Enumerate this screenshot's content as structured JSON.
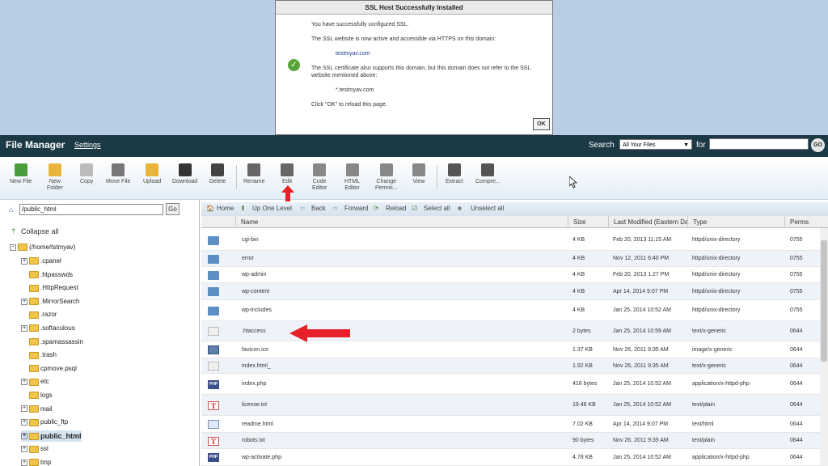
{
  "dialog": {
    "title": "SSL Host Successfully Installed",
    "line1": "You have successfully configured SSL.",
    "line2": "The SSL website is now active and accessible via HTTPS on this domain:",
    "domain": "testmyav.com",
    "line3": "The SSL certificate also supports this domain, but this domain does not refer to the SSL website mentioned above:",
    "wildcard": "*.testmyav.com",
    "line4": "Click \"OK\" to reload this page.",
    "ok_label": "OK"
  },
  "header": {
    "title": "File Manager",
    "settings": "Settings",
    "search_label": "Search",
    "search_scope": "All Your Files",
    "for_label": "for",
    "go_label": "GO"
  },
  "toolbar": [
    {
      "label": "New File",
      "icon": "new-file-icon"
    },
    {
      "label": "New\nFolder",
      "icon": "new-folder-icon"
    },
    {
      "label": "Copy",
      "icon": "copy-icon"
    },
    {
      "label": "Move File",
      "icon": "move-file-icon"
    },
    {
      "label": "Upload",
      "icon": "upload-icon"
    },
    {
      "label": "Download",
      "icon": "download-icon"
    },
    {
      "label": "Delete",
      "icon": "delete-icon"
    },
    {
      "label": "Rename",
      "icon": "rename-icon"
    },
    {
      "label": "Edit",
      "icon": "edit-icon"
    },
    {
      "label": "Code\nEditor",
      "icon": "code-editor-icon"
    },
    {
      "label": "HTML\nEditor",
      "icon": "html-editor-icon"
    },
    {
      "label": "Change\nPermis...",
      "icon": "change-permissions-icon"
    },
    {
      "label": "View",
      "icon": "view-icon"
    },
    {
      "label": "Extract",
      "icon": "extract-icon"
    },
    {
      "label": "Compre...",
      "icon": "compress-icon"
    }
  ],
  "tree": {
    "path": "/public_html",
    "go_label": "Go",
    "collapse_all": "Collapse all",
    "root": "(/home/tstmyav)",
    "items": [
      {
        "label": ".cpanel",
        "expandable": true
      },
      {
        "label": ".htpasswds",
        "expandable": false
      },
      {
        "label": ".HttpRequest",
        "expandable": false
      },
      {
        "label": ".MirrorSearch",
        "expandable": true
      },
      {
        "label": ".razor",
        "expandable": false
      },
      {
        "label": ".softaculous",
        "expandable": true
      },
      {
        "label": ".spamassassin",
        "expandable": false
      },
      {
        "label": ".trash",
        "expandable": false
      },
      {
        "label": "cpmove.psql",
        "expandable": false
      },
      {
        "label": "etc",
        "expandable": true
      },
      {
        "label": "logs",
        "expandable": false
      },
      {
        "label": "mail",
        "expandable": true
      },
      {
        "label": "public_ftp",
        "expandable": true
      },
      {
        "label": "public_html",
        "expandable": true,
        "selected": true
      },
      {
        "label": "ssl",
        "expandable": true
      },
      {
        "label": "tmp",
        "expandable": true
      }
    ]
  },
  "list_toolbar": {
    "home": "Home",
    "up": "Up One Level",
    "back": "Back",
    "forward": "Forward",
    "reload": "Reload",
    "select_all": "Select all",
    "unselect_all": "Unselect all"
  },
  "columns": {
    "name": "Name",
    "size": "Size",
    "modified": "Last Modified (Eastern Da",
    "type": "Type",
    "perms": "Perms"
  },
  "files": [
    {
      "name": "cgi-bin",
      "size": "4 KB",
      "modified": "Feb 20, 2013 11:15 AM",
      "type": "httpd/unix-directory",
      "perms": "0755",
      "icon": "folder"
    },
    {
      "name": "error",
      "size": "4 KB",
      "modified": "Nov 12, 2011 6:40 PM",
      "type": "httpd/unix-directory",
      "perms": "0755",
      "icon": "folder"
    },
    {
      "name": "wp-admin",
      "size": "4 KB",
      "modified": "Feb 20, 2013 1:27 PM",
      "type": "httpd/unix-directory",
      "perms": "0755",
      "icon": "folder"
    },
    {
      "name": "wp-content",
      "size": "4 KB",
      "modified": "Apr 14, 2014 9:07 PM",
      "type": "httpd/unix-directory",
      "perms": "0755",
      "icon": "folder"
    },
    {
      "name": "wp-includes",
      "size": "4 KB",
      "modified": "Jan 25, 2014 10:52 AM",
      "type": "httpd/unix-directory",
      "perms": "0755",
      "icon": "folder"
    },
    {
      "name": ".htaccess",
      "size": "2 bytes",
      "modified": "Jan 25, 2014 10:59 AM",
      "type": "text/x-generic",
      "perms": "0644",
      "icon": "txt"
    },
    {
      "name": "favicon.ico",
      "size": "1.37 KB",
      "modified": "Nov 26, 2011 9:35 AM",
      "type": "image/x-generic",
      "perms": "0644",
      "icon": "img"
    },
    {
      "name": "index.html_",
      "size": "1.92 KB",
      "modified": "Nov 26, 2011 9:35 AM",
      "type": "text/x-generic",
      "perms": "0644",
      "icon": "txt"
    },
    {
      "name": "index.php",
      "size": "418 bytes",
      "modified": "Jan 25, 2014 10:52 AM",
      "type": "application/x-httpd-php",
      "perms": "0644",
      "icon": "php"
    },
    {
      "name": "license.txt",
      "size": "19.46 KB",
      "modified": "Jan 25, 2014 10:52 AM",
      "type": "text/plain",
      "perms": "0644",
      "icon": "t"
    },
    {
      "name": "readme.html",
      "size": "7.02 KB",
      "modified": "Apr 14, 2014 9:07 PM",
      "type": "text/html",
      "perms": "0644",
      "icon": "html"
    },
    {
      "name": "robots.txt",
      "size": "90 bytes",
      "modified": "Nov 26, 2011 9:35 AM",
      "type": "text/plain",
      "perms": "0644",
      "icon": "t"
    },
    {
      "name": "wp-activate.php",
      "size": "4.78 KB",
      "modified": "Jan 25, 2014 10:52 AM",
      "type": "application/x-httpd-php",
      "perms": "0644",
      "icon": "php"
    }
  ]
}
